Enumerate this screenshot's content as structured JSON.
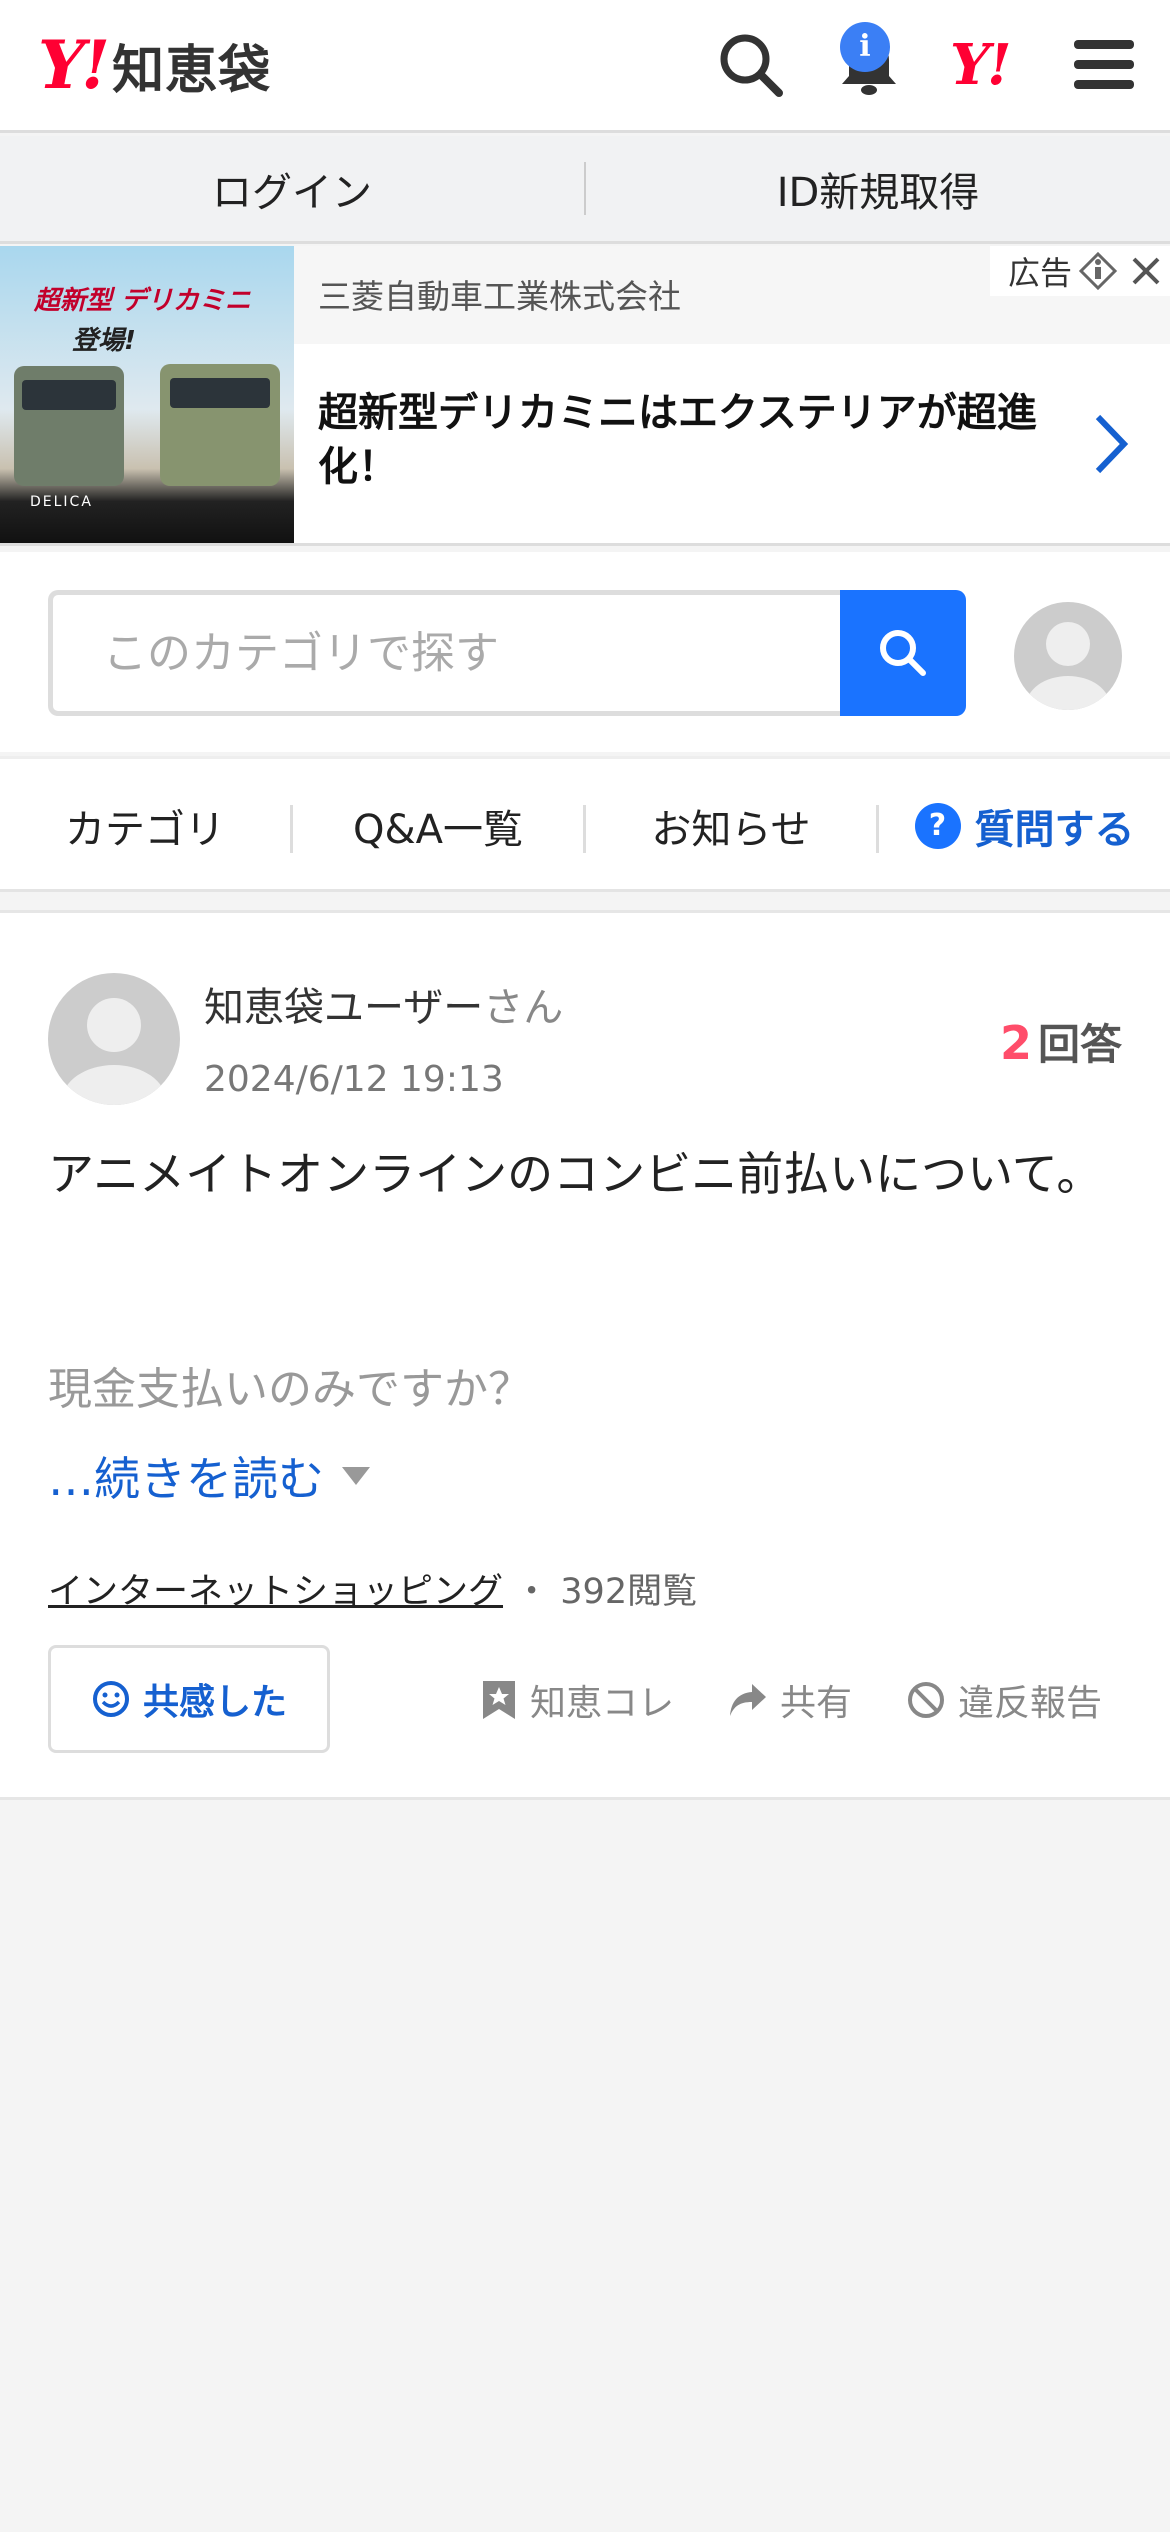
{
  "header": {
    "logo_mark": "Y!",
    "logo_text": "知恵袋",
    "notification_badge": "i",
    "yahoo_mark": "Y!"
  },
  "loginbar": {
    "login_label": "ログイン",
    "signup_label": "ID新規取得"
  },
  "ad": {
    "image_title_line1": "超新型 デリカミニ",
    "image_title_line2": "登場!",
    "image_brand": "DELICA",
    "advertiser": "三菱自動車工業株式会社",
    "label": "広告",
    "headline": "超新型デリカミニはエクステリアが超進化！"
  },
  "search": {
    "placeholder": "このカテゴリで探す"
  },
  "nav": {
    "category": "カテゴリ",
    "qa_list": "Q&A一覧",
    "news": "お知らせ",
    "ask": "質問する",
    "ask_icon_glyph": "?"
  },
  "question": {
    "username": "知恵袋ユーザー",
    "username_suffix": "さん",
    "date": "2024/6/12 19:13",
    "answer_count": "2",
    "answer_label": "回答",
    "title": "アニメイトオンラインのコンビニ前払いについて。",
    "body": "現金支払いのみですか？",
    "read_more": "…続きを読む",
    "category": "インターネットショッピング",
    "views_separator": " ・ ",
    "views": "392閲覧",
    "empathy_button": "共感した",
    "actions": {
      "save": "知恵コレ",
      "share": "共有",
      "report": "違反報告"
    }
  },
  "colors": {
    "brand_red": "#ff0033",
    "link_blue": "#1560d0",
    "search_blue": "#1a73ff",
    "answer_count_pink": "#ff4d6a"
  }
}
